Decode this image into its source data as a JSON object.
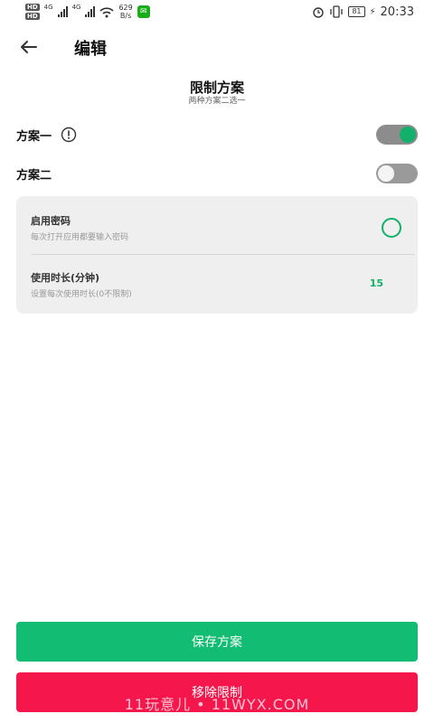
{
  "status_bar": {
    "hd1": "HD",
    "hd2": "HD",
    "net1": "4G",
    "net2": "4G",
    "speed_value": "629",
    "speed_unit": "B/s",
    "battery": "81",
    "time": "20:33"
  },
  "header": {
    "title": "编辑"
  },
  "section": {
    "title": "限制方案",
    "subtitle": "两种方案二选一"
  },
  "plans": [
    {
      "label": "方案一",
      "enabled": true
    },
    {
      "label": "方案二",
      "enabled": false
    }
  ],
  "settings": {
    "password": {
      "title": "启用密码",
      "desc": "每次打开应用都要输入密码"
    },
    "duration": {
      "title": "使用时长(分钟)",
      "desc": "设置每次使用时长(0不限制)",
      "value": "15"
    }
  },
  "buttons": {
    "save": "保存方案",
    "remove": "移除限制"
  },
  "watermark": "11玩意儿 • 11WYX.COM",
  "colors": {
    "accent_green": "#12bc73",
    "danger_red": "#f5174c"
  }
}
